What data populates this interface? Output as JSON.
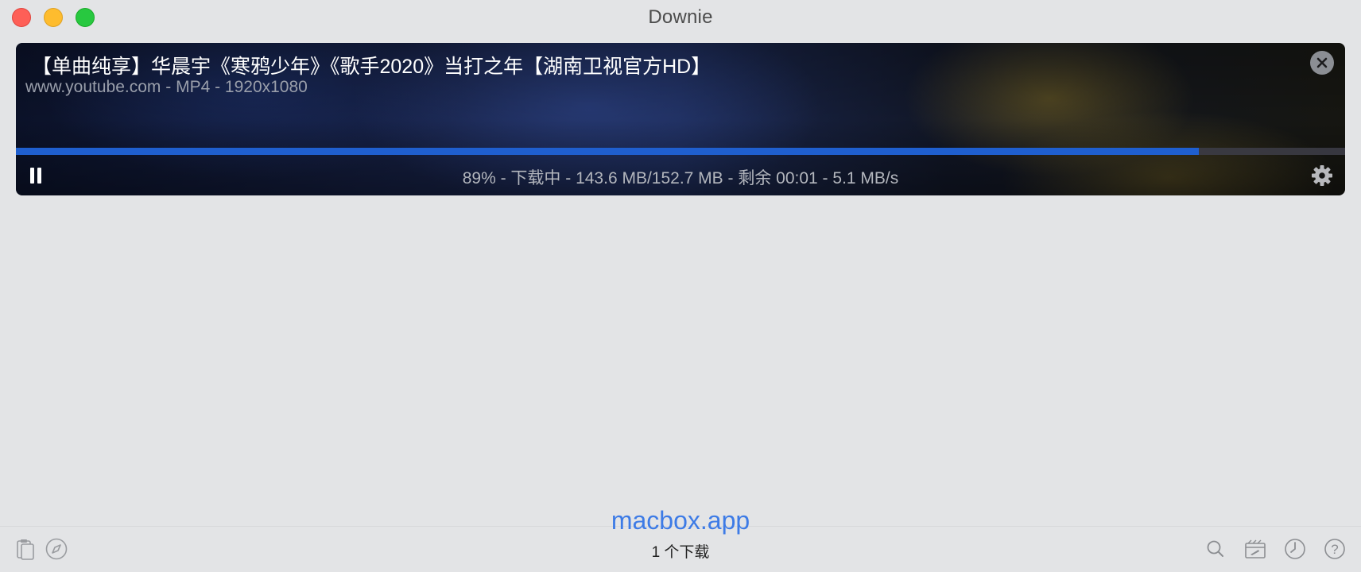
{
  "window": {
    "title": "Downie"
  },
  "download": {
    "title": "【单曲纯享】华晨宇《寒鸦少年》《歌手2020》当打之年【湖南卫视官方HD】",
    "meta": "www.youtube.com - MP4 - 1920x1080",
    "progress": 0.89,
    "status": "89% - 下载中 - 143.6 MB/152.7 MB - 剩余 00:01 - 5.1 MB/s",
    "accent": "#1f5fcf"
  },
  "footer": {
    "watermark": "macbox.app",
    "count": "1 个下载"
  },
  "icons": {
    "left": [
      "clipboard-icon",
      "compass-icon"
    ],
    "right": [
      "search-icon",
      "post-processing-icon",
      "history-clock-icon",
      "help-icon"
    ]
  }
}
